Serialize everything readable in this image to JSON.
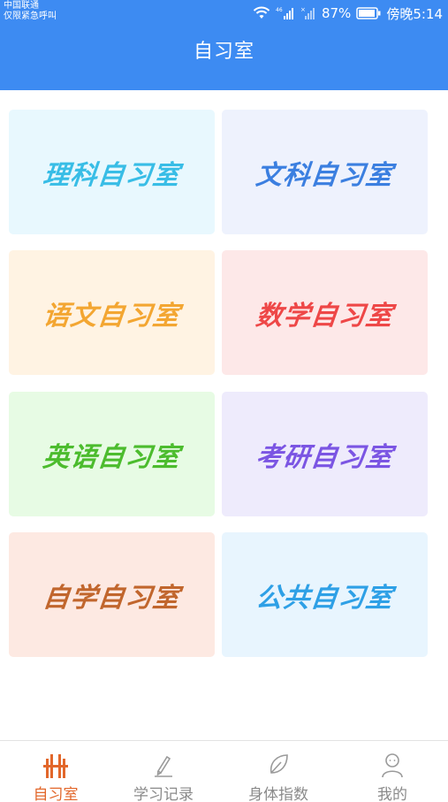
{
  "status_bar": {
    "carrier_line1": "中国联通",
    "carrier_line2": "仅限紧急呼叫",
    "battery": "87%",
    "time": "傍晚5:14",
    "icons": [
      "wifi-icon",
      "signal-icon",
      "signal-icon",
      "battery-icon"
    ]
  },
  "header": {
    "title": "自习室"
  },
  "rooms": [
    {
      "label": "理科自习室",
      "text_color": "#38bde6",
      "bg_color": "#e8f8fe"
    },
    {
      "label": "文科自习室",
      "text_color": "#3b7fe0",
      "bg_color": "#eef2fd"
    },
    {
      "label": "语文自习室",
      "text_color": "#f3a632",
      "bg_color": "#fff3e3"
    },
    {
      "label": "数学自习室",
      "text_color": "#ee4747",
      "bg_color": "#fde8e8"
    },
    {
      "label": "英语自习室",
      "text_color": "#4cbc2e",
      "bg_color": "#e7fbe4"
    },
    {
      "label": "考研自习室",
      "text_color": "#7b55e3",
      "bg_color": "#eeebfc"
    },
    {
      "label": "自学自习室",
      "text_color": "#c1662d",
      "bg_color": "#fde9e2"
    },
    {
      "label": "公共自习室",
      "text_color": "#2ea0e6",
      "bg_color": "#e8f5fe"
    }
  ],
  "tabs": [
    {
      "label": "自习室",
      "icon": "study-room-icon",
      "active": true
    },
    {
      "label": "学习记录",
      "icon": "pen-icon",
      "active": false
    },
    {
      "label": "身体指数",
      "icon": "leaf-icon",
      "active": false
    },
    {
      "label": "我的",
      "icon": "user-icon",
      "active": false
    }
  ],
  "colors": {
    "header": "#3d8bf2",
    "active_tab": "#e2672b",
    "inactive_tab": "#8a8a8a"
  }
}
